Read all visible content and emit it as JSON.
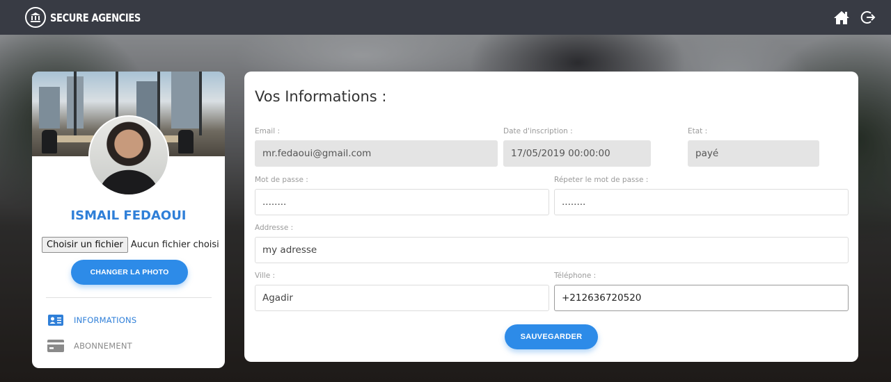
{
  "navbar": {
    "brand": "SECURE AGENCIES",
    "icons": [
      "bank-icon",
      "home-icon",
      "logout-icon"
    ]
  },
  "profile": {
    "name": "ISMAIL FEDAOUI",
    "file_button": "Choisir un fichier",
    "file_status": "Aucun fichier choisi",
    "change_photo": "CHANGER LA PHOTO",
    "menu": [
      {
        "label": "INFORMATIONS",
        "icon": "id-card-icon",
        "active": true
      },
      {
        "label": "ABONNEMENT",
        "icon": "credit-card-icon",
        "active": false
      }
    ]
  },
  "form": {
    "title": "Vos Informations :",
    "email_label": "Email :",
    "email_value": "mr.fedaoui@gmail.com",
    "date_label": "Date d'inscription :",
    "date_value": "17/05/2019 00:00:00",
    "etat_label": "Etat :",
    "etat_value": "payé",
    "password_label": "Mot de passe :",
    "password_value": "........",
    "password_repeat_label": "Répeter le mot de passe :",
    "password_repeat_value": "........",
    "address_label": "Addresse :",
    "address_value": "my adresse",
    "city_label": "Ville :",
    "city_value": "Agadir",
    "phone_label": "Téléphone :",
    "phone_value": "+212636720520",
    "save_button": "SAUVEGARDER"
  },
  "colors": {
    "accent": "#2d8be8",
    "navbar": "#383b44",
    "name": "#2f7fd8"
  }
}
